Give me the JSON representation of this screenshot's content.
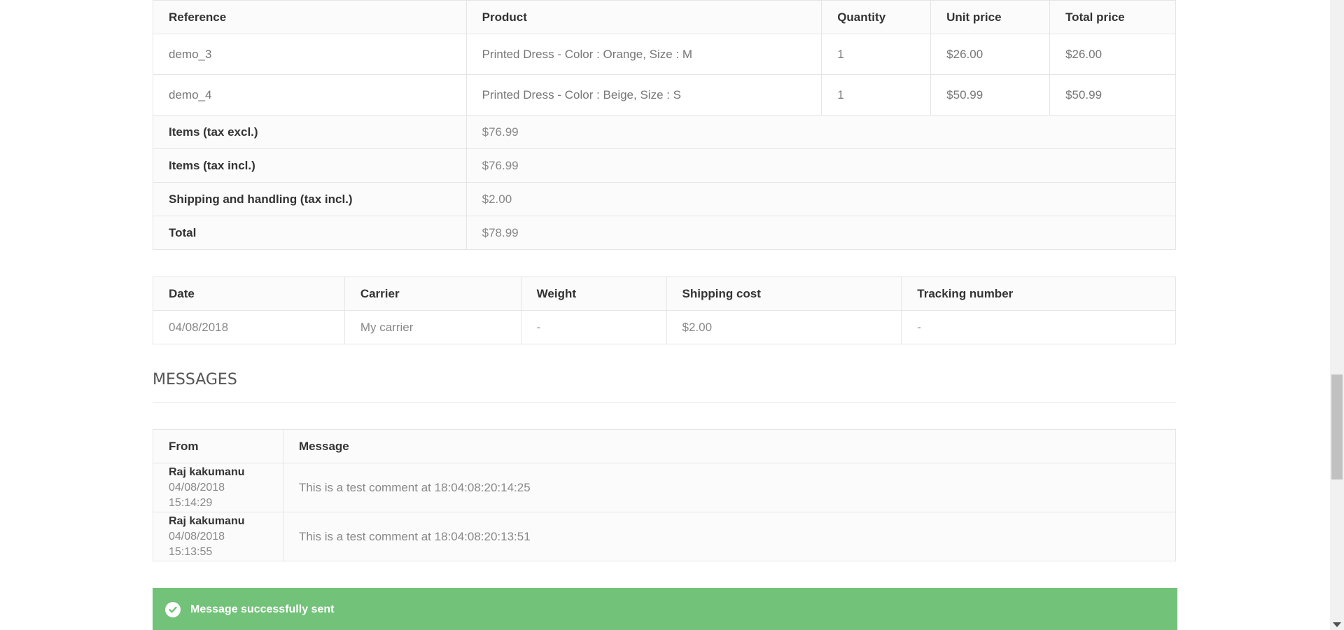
{
  "order_table": {
    "headers": [
      "Reference",
      "Product",
      "Quantity",
      "Unit price",
      "Total price"
    ],
    "rows": [
      {
        "reference": "demo_3",
        "product": "Printed Dress - Color : Orange, Size : M",
        "quantity": "1",
        "unit_price": "$26.00",
        "total_price": "$26.00"
      },
      {
        "reference": "demo_4",
        "product": "Printed Dress - Color : Beige, Size : S",
        "quantity": "1",
        "unit_price": "$50.99",
        "total_price": "$50.99"
      }
    ],
    "summary": [
      {
        "label": "Items (tax excl.)",
        "value": "$76.99"
      },
      {
        "label": "Items (tax incl.)",
        "value": "$76.99"
      },
      {
        "label": "Shipping and handling (tax incl.)",
        "value": "$2.00"
      },
      {
        "label": "Total",
        "value": "$78.99"
      }
    ]
  },
  "shipping_table": {
    "headers": [
      "Date",
      "Carrier",
      "Weight",
      "Shipping cost",
      "Tracking number"
    ],
    "rows": [
      {
        "date": "04/08/2018",
        "carrier": "My carrier",
        "weight": "-",
        "shipping_cost": "$2.00",
        "tracking_number": "-"
      }
    ]
  },
  "messages": {
    "title": "MESSAGES",
    "headers": [
      "From",
      "Message"
    ],
    "rows": [
      {
        "from_name": "Raj kakumanu",
        "from_date": "04/08/2018 15:14:29",
        "message": "This is a test comment at 18:04:08:20:14:25"
      },
      {
        "from_name": "Raj kakumanu",
        "from_date": "04/08/2018 15:13:55",
        "message": "This is a test comment at 18:04:08:20:13:51"
      }
    ]
  },
  "alert": {
    "text": "Message successfully sent",
    "icon": "check-circle-icon",
    "color": "#72c279"
  }
}
